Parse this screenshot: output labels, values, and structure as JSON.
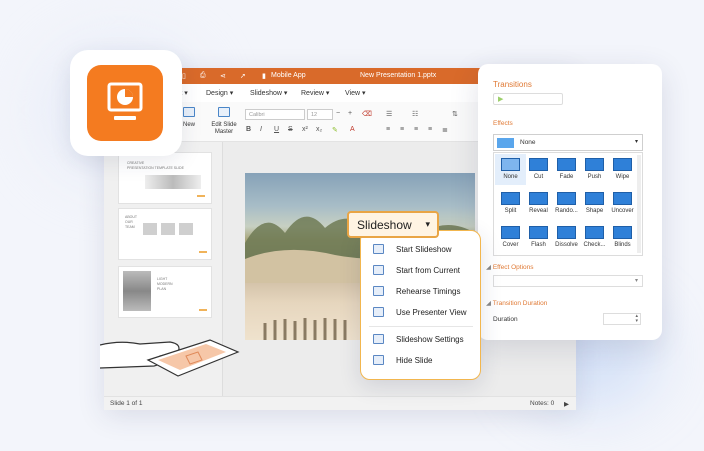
{
  "app_icon": {
    "name": "presentation-app-icon",
    "color": "#f47b20"
  },
  "window": {
    "title": "New Presentation 1.pptx",
    "mobile_app": "Mobile App",
    "tabs": [
      "rt ▾",
      "Design ▾",
      "Slideshow ▾",
      "Review ▾",
      "View ▾"
    ],
    "ribbon": {
      "new_label": "New",
      "edit_master_label": "Edit Slide\nMaster",
      "font_name": "Calibri",
      "font_size": "12"
    },
    "status": {
      "slide_count": "Slide 1 of 1",
      "notes": "Notes: 0"
    },
    "accent": "#d96a2a"
  },
  "thumbnails": [
    {
      "title": "CREATIVE\nPRESENTATION TEMPLATE SLIDE"
    },
    {
      "title": "ABOUT\nOUR\nTEAM"
    },
    {
      "title": "LIGHT\nMODERN\nPLAN"
    }
  ],
  "slideshow_button": {
    "label": "Slideshow"
  },
  "slideshow_menu": [
    {
      "label": "Start Slideshow",
      "icon": "play-slide-icon"
    },
    {
      "label": "Start from Current",
      "icon": "play-current-icon"
    },
    {
      "label": "Rehearse Timings",
      "icon": "timer-slide-icon"
    },
    {
      "label": "Use Presenter View",
      "icon": "presenter-icon"
    },
    {
      "label": "Slideshow Settings",
      "icon": "settings-slide-icon"
    },
    {
      "label": "Hide Slide",
      "icon": "hide-slide-icon"
    }
  ],
  "transitions": {
    "title": "Transitions",
    "effects_label": "Effects",
    "selected_effect": "None",
    "effects": [
      "None",
      "Cut",
      "Fade",
      "Push",
      "Wipe",
      "Split",
      "Reveal",
      "Rando...",
      "Shape",
      "Uncover",
      "Cover",
      "Flash",
      "Dissolve",
      "Check...",
      "Blinds"
    ],
    "effect_options_label": "Effect Options",
    "duration_section": "Transition Duration",
    "duration_label": "Duration",
    "accent": "#e07a35"
  }
}
